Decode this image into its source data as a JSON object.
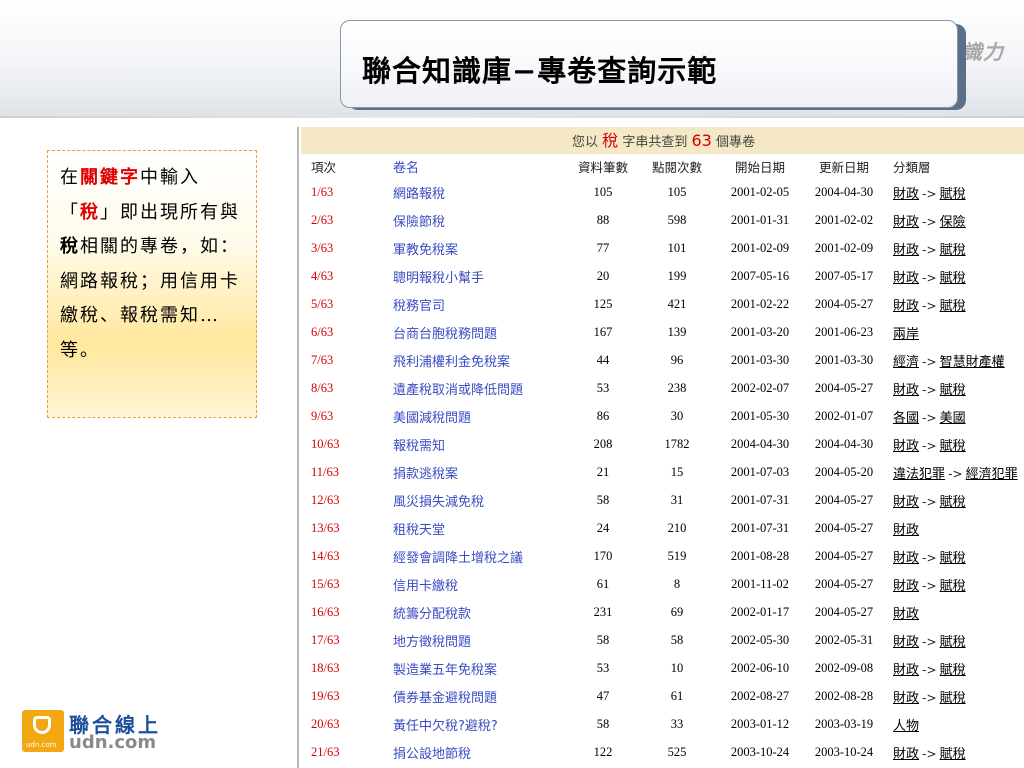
{
  "slide": {
    "title": "聯合知識庫−專卷查詢示範",
    "brand_mark": "識力"
  },
  "note": {
    "t1": "在",
    "kw1": "關鍵字",
    "t2": "中輸入「",
    "kw2": "稅",
    "t3": "」即出現所有與",
    "kw3": "稅",
    "t4": "相關的專卷，如：網路報稅；用信用卡繳稅、報稅需知…等。"
  },
  "summary": {
    "prefix": "您以",
    "keyword": "稅",
    "middle": "字串共查到",
    "count": "63",
    "suffix": "個專卷"
  },
  "columns": {
    "no": "項次",
    "name": "卷名",
    "records": "資料筆數",
    "views": "點閱次數",
    "start": "開始日期",
    "updated": "更新日期",
    "category": "分類層"
  },
  "rows": [
    {
      "no": "1/63",
      "name": "網路報稅",
      "records": "105",
      "views": "105",
      "start": "2001-02-05",
      "updated": "2004-04-30",
      "cat1": "財政",
      "cat2": "賦稅"
    },
    {
      "no": "2/63",
      "name": "保險節稅",
      "records": "88",
      "views": "598",
      "start": "2001-01-31",
      "updated": "2001-02-02",
      "cat1": "財政",
      "cat2": "保險"
    },
    {
      "no": "3/63",
      "name": "軍教免稅案",
      "records": "77",
      "views": "101",
      "start": "2001-02-09",
      "updated": "2001-02-09",
      "cat1": "財政",
      "cat2": "賦稅"
    },
    {
      "no": "4/63",
      "name": "聰明報稅小幫手",
      "records": "20",
      "views": "199",
      "start": "2007-05-16",
      "updated": "2007-05-17",
      "cat1": "財政",
      "cat2": "賦稅"
    },
    {
      "no": "5/63",
      "name": "稅務官司",
      "records": "125",
      "views": "421",
      "start": "2001-02-22",
      "updated": "2004-05-27",
      "cat1": "財政",
      "cat2": "賦稅"
    },
    {
      "no": "6/63",
      "name": "台商台胞稅務問題",
      "records": "167",
      "views": "139",
      "start": "2001-03-20",
      "updated": "2001-06-23",
      "cat1": "兩岸",
      "cat2": ""
    },
    {
      "no": "7/63",
      "name": "飛利浦權利金免稅案",
      "records": "44",
      "views": "96",
      "start": "2001-03-30",
      "updated": "2001-03-30",
      "cat1": "經濟",
      "cat2": "智慧財產權"
    },
    {
      "no": "8/63",
      "name": "遺產稅取消或降低問題",
      "records": "53",
      "views": "238",
      "start": "2002-02-07",
      "updated": "2004-05-27",
      "cat1": "財政",
      "cat2": "賦稅"
    },
    {
      "no": "9/63",
      "name": "美國減稅問題",
      "records": "86",
      "views": "30",
      "start": "2001-05-30",
      "updated": "2002-01-07",
      "cat1": "各國",
      "cat2": "美國"
    },
    {
      "no": "10/63",
      "name": "報稅需知",
      "records": "208",
      "views": "1782",
      "start": "2004-04-30",
      "updated": "2004-04-30",
      "cat1": "財政",
      "cat2": "賦稅"
    },
    {
      "no": "11/63",
      "name": "捐款逃稅案",
      "records": "21",
      "views": "15",
      "start": "2001-07-03",
      "updated": "2004-05-20",
      "cat1": "違法犯罪",
      "cat2": "經濟犯罪"
    },
    {
      "no": "12/63",
      "name": "風災損失減免稅",
      "records": "58",
      "views": "31",
      "start": "2001-07-31",
      "updated": "2004-05-27",
      "cat1": "財政",
      "cat2": "賦稅"
    },
    {
      "no": "13/63",
      "name": "租稅天堂",
      "records": "24",
      "views": "210",
      "start": "2001-07-31",
      "updated": "2004-05-27",
      "cat1": "財政",
      "cat2": ""
    },
    {
      "no": "14/63",
      "name": "經發會調降土增稅之議",
      "records": "170",
      "views": "519",
      "start": "2001-08-28",
      "updated": "2004-05-27",
      "cat1": "財政",
      "cat2": "賦稅"
    },
    {
      "no": "15/63",
      "name": "信用卡繳稅",
      "records": "61",
      "views": "8",
      "start": "2001-11-02",
      "updated": "2004-05-27",
      "cat1": "財政",
      "cat2": "賦稅"
    },
    {
      "no": "16/63",
      "name": "統籌分配稅款",
      "records": "231",
      "views": "69",
      "start": "2002-01-17",
      "updated": "2004-05-27",
      "cat1": "財政",
      "cat2": ""
    },
    {
      "no": "17/63",
      "name": "地方徵稅問題",
      "records": "58",
      "views": "58",
      "start": "2002-05-30",
      "updated": "2002-05-31",
      "cat1": "財政",
      "cat2": "賦稅"
    },
    {
      "no": "18/63",
      "name": "製造業五年免稅案",
      "records": "53",
      "views": "10",
      "start": "2002-06-10",
      "updated": "2002-09-08",
      "cat1": "財政",
      "cat2": "賦稅"
    },
    {
      "no": "19/63",
      "name": "債券基金避稅問題",
      "records": "47",
      "views": "61",
      "start": "2002-08-27",
      "updated": "2002-08-28",
      "cat1": "財政",
      "cat2": "賦稅"
    },
    {
      "no": "20/63",
      "name": "黃任中欠稅?避稅?",
      "records": "58",
      "views": "33",
      "start": "2003-01-12",
      "updated": "2003-03-19",
      "cat1": "人物",
      "cat2": ""
    },
    {
      "no": "21/63",
      "name": "捐公設地節稅",
      "records": "122",
      "views": "525",
      "start": "2003-10-24",
      "updated": "2003-10-24",
      "cat1": "財政",
      "cat2": "賦稅"
    }
  ],
  "category_separator": "->",
  "logo": {
    "cn": "聯合線上",
    "en": "udn.com",
    "small": "udn.com"
  }
}
